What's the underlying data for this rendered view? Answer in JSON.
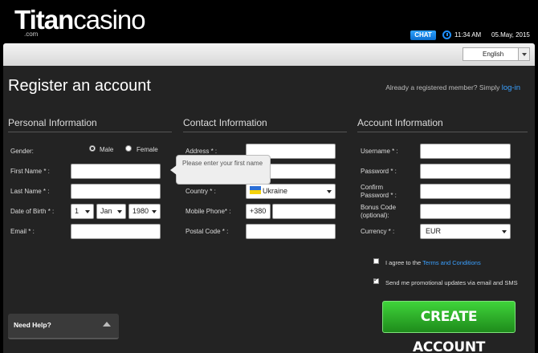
{
  "header": {
    "logo_main": "T",
    "logo_rest1": "itan",
    "logo_rest2": "casino",
    "logo_com": ".com",
    "chat_label": "CHAT",
    "time": "11:34 AM",
    "date": "05.May, 2015"
  },
  "language": {
    "selected": "English"
  },
  "page": {
    "title": "Register an account",
    "already_text": "Already a registered member? Simply ",
    "login_link": "log-in"
  },
  "personal": {
    "title": "Personal Information",
    "gender_label": "Gender:",
    "male_label": "Male",
    "female_label": "Female",
    "first_name_label": "First Name * :",
    "last_name_label": "Last Name * :",
    "dob_label": "Date of Birth * :",
    "dob_day": "1",
    "dob_month": "Jan",
    "dob_year": "1980",
    "email_label": "Email * :"
  },
  "tooltip": {
    "text": "Please enter your first name"
  },
  "contact": {
    "title": "Contact Information",
    "address_label": "Address * :",
    "city_label": "",
    "country_label": "Country * :",
    "country_value": "Ukraine",
    "phone_label": "Mobile Phone* :",
    "phone_prefix": "+380",
    "postal_label": "Postal Code * :"
  },
  "account": {
    "title": "Account Information",
    "username_label": "Username * :",
    "password_label": "Password * :",
    "confirm_label_1": "Confirm",
    "confirm_label_2": "Password * :",
    "bonus_label_1": "Bonus Code",
    "bonus_label_2": "(optional):",
    "currency_label": "Currency * :",
    "currency_value": "EUR"
  },
  "agreements": {
    "terms_prefix": "I agree to the ",
    "terms_link": "Terms and Conditions",
    "promo_text": "Send me promotional updates via email and SMS"
  },
  "create_button": "CREATE ACCOUNT",
  "help": {
    "label": "Need Help?"
  },
  "colors": {
    "accent_blue": "#3aa0ff",
    "button_green": "#2cb229",
    "panel": "#232323"
  }
}
